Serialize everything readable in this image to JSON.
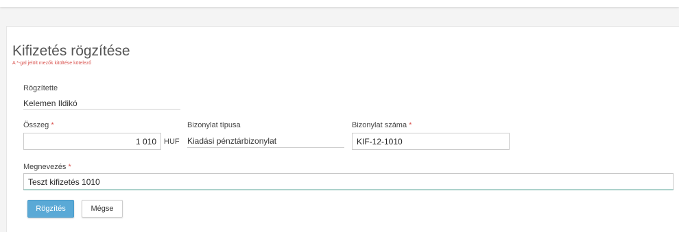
{
  "form": {
    "title": "Kifizetés rögzítése",
    "required_note": "A *-gal jelölt mezők kitöltése kötelező",
    "recorded_by": {
      "label": "Rögzítette",
      "value": "Kelemen Ildikó"
    },
    "amount": {
      "label": "Összeg",
      "required_mark": "*",
      "value": "1 010",
      "currency": "HUF"
    },
    "document_type": {
      "label": "Bizonylat típusa",
      "value": "Kiadási pénztárbizonylat"
    },
    "document_number": {
      "label": "Bizonylat száma",
      "required_mark": "*",
      "value": "KIF-12-1010"
    },
    "name": {
      "label": "Megnevezés",
      "required_mark": "*",
      "value": "Teszt kifizetés 1010"
    },
    "buttons": {
      "save": "Rögzítés",
      "cancel": "Mégse"
    }
  },
  "colors": {
    "primary_button": "#5aa9d6",
    "required": "#d9534f",
    "focus_underline": "#2a8a7a"
  }
}
